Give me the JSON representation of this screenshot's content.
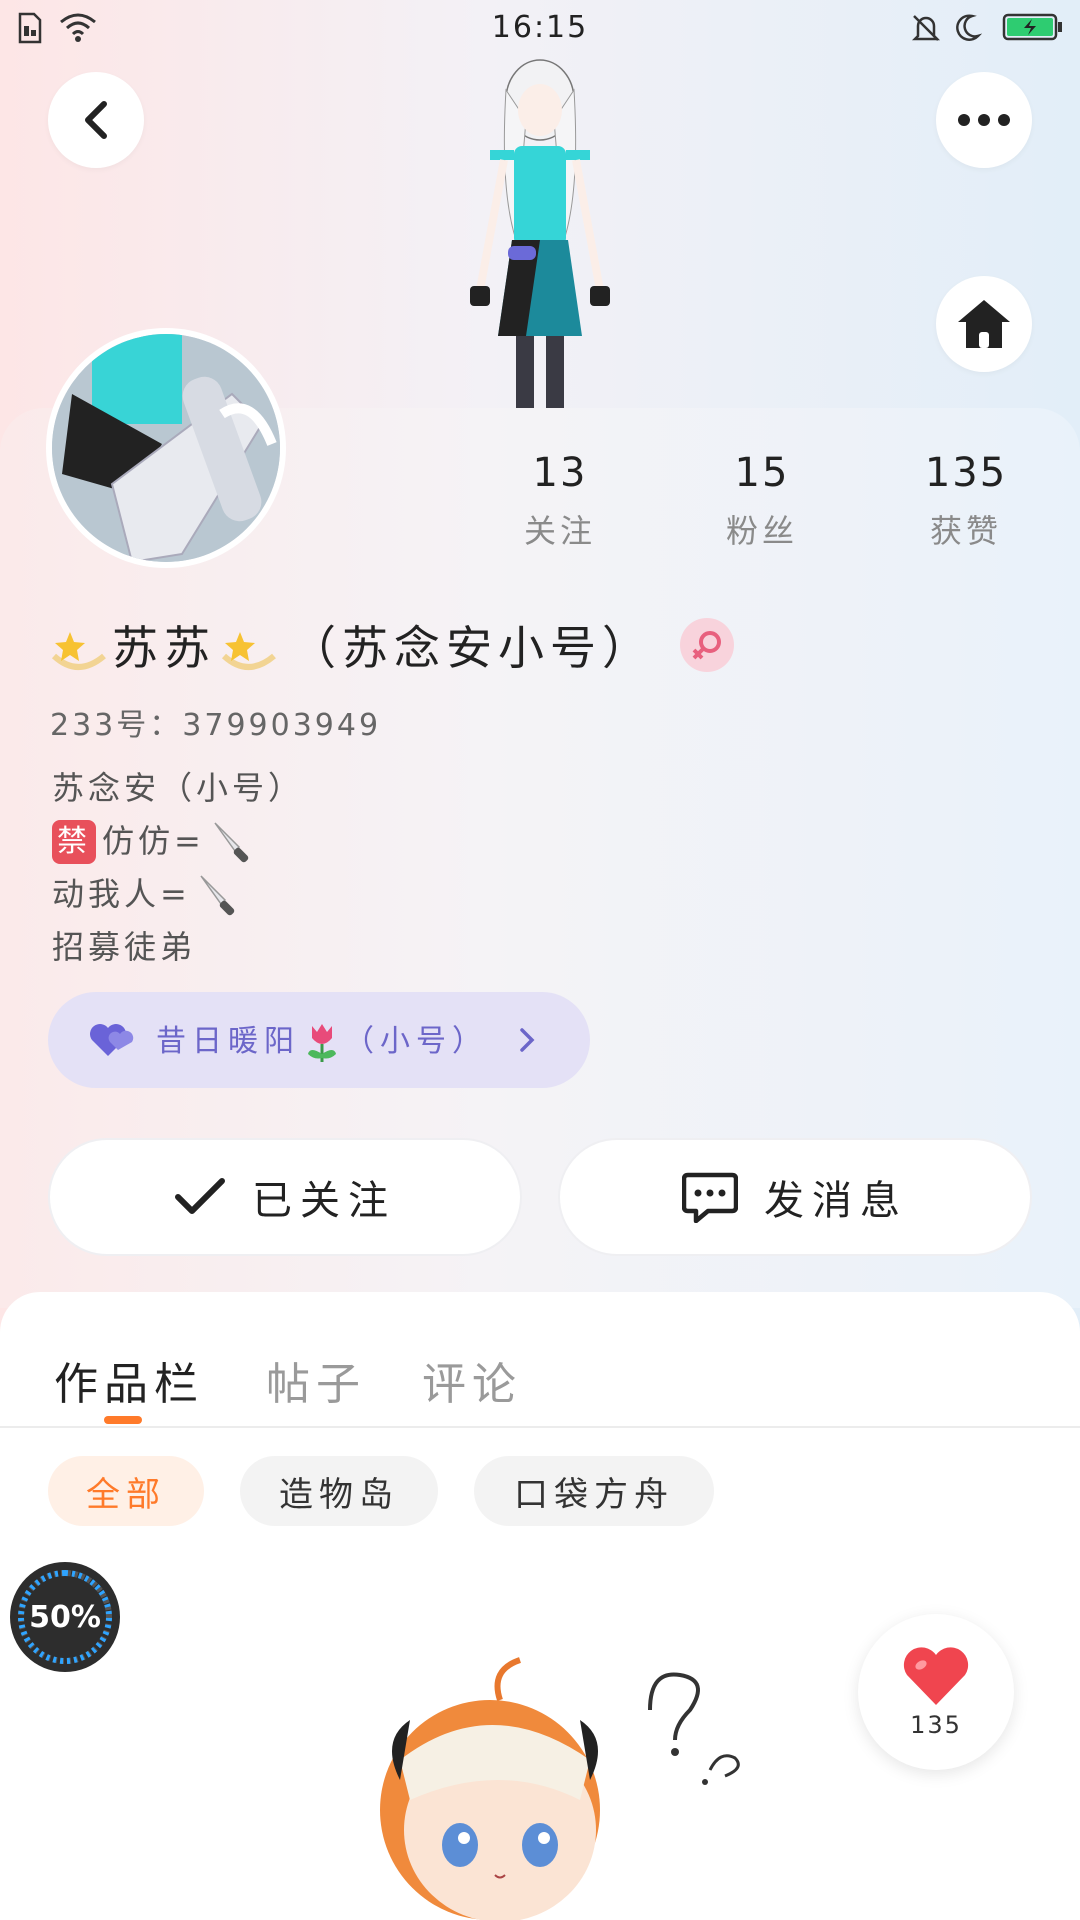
{
  "status_bar": {
    "time": "16:15"
  },
  "profile": {
    "stats": [
      {
        "value": "13",
        "label": "关注"
      },
      {
        "value": "15",
        "label": "粉丝"
      },
      {
        "value": "135",
        "label": "获赞"
      }
    ],
    "name": "苏苏",
    "name_suffix": "（苏念安小号）",
    "uid_label": "233号：",
    "uid_value": "379903949",
    "bio": {
      "line1": "苏念安（小号）",
      "line2_ban": "禁",
      "line2_text": "仿仿=",
      "line3_text": "动我人=",
      "line4": "招募徒弟"
    },
    "relation_chip": {
      "label_pre": "昔日暖阳",
      "label_post": "（小号）"
    },
    "follow_button_label": "已关注",
    "message_button_label": "发消息"
  },
  "tabs": [
    {
      "label": "作品栏"
    },
    {
      "label": "帖子"
    },
    {
      "label": "评论"
    }
  ],
  "filters": [
    {
      "label": "全部"
    },
    {
      "label": "造物岛"
    },
    {
      "label": "口袋方舟"
    }
  ],
  "progress": {
    "label": "50%",
    "value": 0.5
  },
  "like_fab": {
    "count": "135"
  },
  "colors": {
    "accent_orange": "#ff7a2a",
    "relation_purple": "#6c66c9",
    "heart_red": "#f0454f",
    "battery_green": "#2ecc71"
  }
}
